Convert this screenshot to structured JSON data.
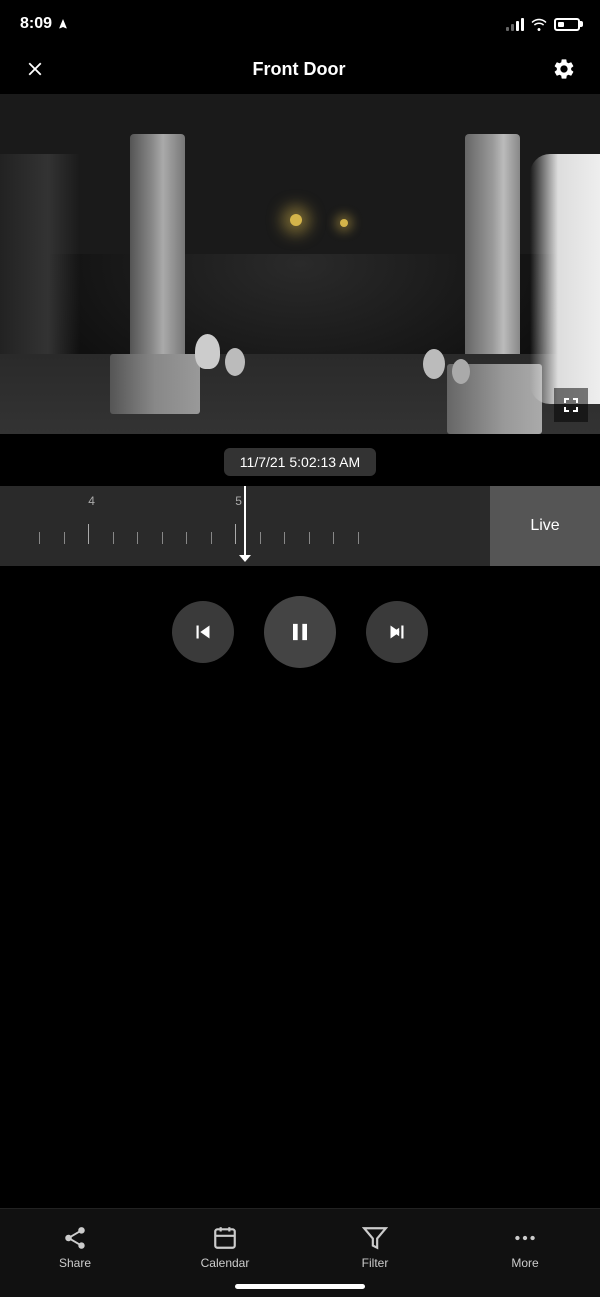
{
  "status": {
    "time": "8:09",
    "time_icon": "location-arrow"
  },
  "header": {
    "title": "Front Door",
    "close_label": "×",
    "settings_label": "⚙"
  },
  "video": {
    "timestamp": "11/7/21 5:02:13 AM",
    "fullscreen_label": "fullscreen"
  },
  "timeline": {
    "label_left": "4",
    "label_right": "5",
    "live_label": "Live"
  },
  "controls": {
    "skip_back_label": "skip-back",
    "pause_label": "pause",
    "skip_forward_label": "skip-forward"
  },
  "bottomnav": {
    "share_label": "Share",
    "calendar_label": "Calendar",
    "filter_label": "Filter",
    "more_label": "More"
  }
}
